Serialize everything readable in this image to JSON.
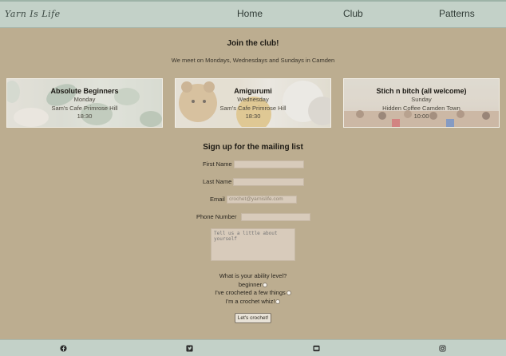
{
  "header": {
    "logo": "Yarn Is Life",
    "nav": [
      "Home",
      "Club",
      "Patterns"
    ]
  },
  "join": {
    "title": "Join the club!",
    "subtitle": "We meet on Mondays, Wednesdays and Sundays in Camden"
  },
  "clubs": [
    {
      "name": "Absolute Beginners",
      "day": "Monday",
      "place": "Sam's Cafe Primrose Hill",
      "time": "18:30"
    },
    {
      "name": "Amigurumi",
      "day": "Wednesday",
      "place": "Sam's Cafe Primrose Hill",
      "time": "18:30"
    },
    {
      "name": "Stich n bitch (all welcome)",
      "day": "Sunday",
      "place": "Hidden Coffee Camden Town",
      "time": "10:00"
    }
  ],
  "form": {
    "title": "Sign up for the mailing list",
    "first_name_label": "First Name",
    "last_name_label": "Last Name",
    "email_label": "Email",
    "email_placeholder": "crochet@yarnislife.com",
    "phone_label": "Phone Number",
    "about_placeholder": "Tell us a little about yourself",
    "ability_question": "What is your ability level?",
    "options": [
      "beginner",
      "I've crocheted a few things",
      "I'm a crochet whiz!"
    ],
    "submit_label": "Let's crochet!"
  },
  "footer": {
    "icons": [
      "facebook-icon",
      "twitter-icon",
      "youtube-icon",
      "instagram-icon"
    ]
  }
}
